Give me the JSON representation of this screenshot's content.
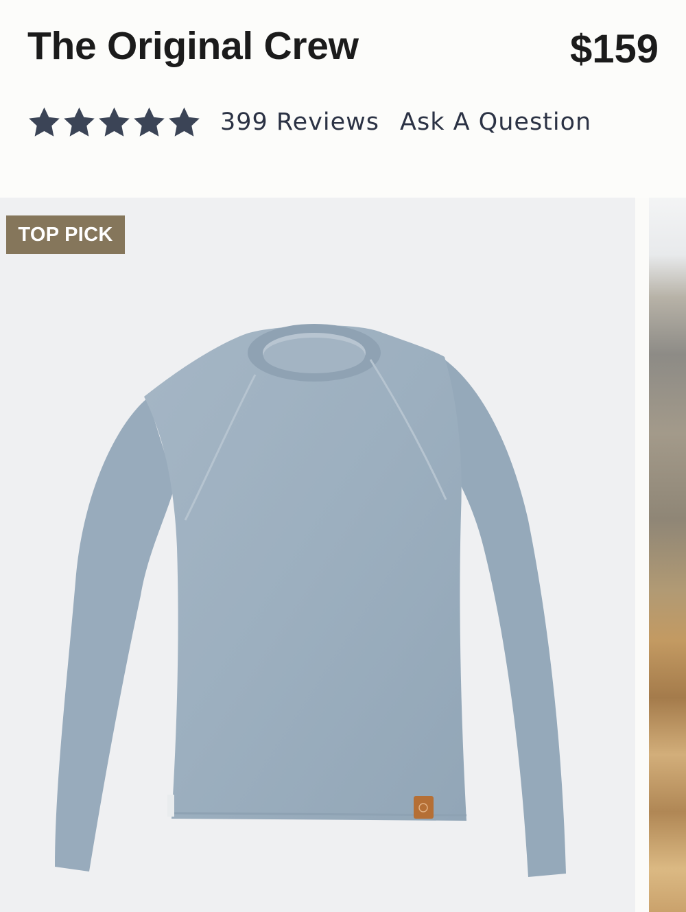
{
  "product": {
    "title": "The Original Crew",
    "price": "$159"
  },
  "rating": {
    "stars": 5,
    "max_stars": 5,
    "icon": "star-icon",
    "color": "#3b4456",
    "reviews_label": "399 Reviews",
    "ask_label": "Ask A Question"
  },
  "gallery": {
    "badge": "TOP PICK",
    "badge_color": "#85765b",
    "main_image": "grey-crewneck-sweater",
    "next_image": "desert-badlands-landscape"
  },
  "colors": {
    "background": "#fcfcfa",
    "image_background": "#eff0f2",
    "sweater": "#9fb1c1"
  }
}
